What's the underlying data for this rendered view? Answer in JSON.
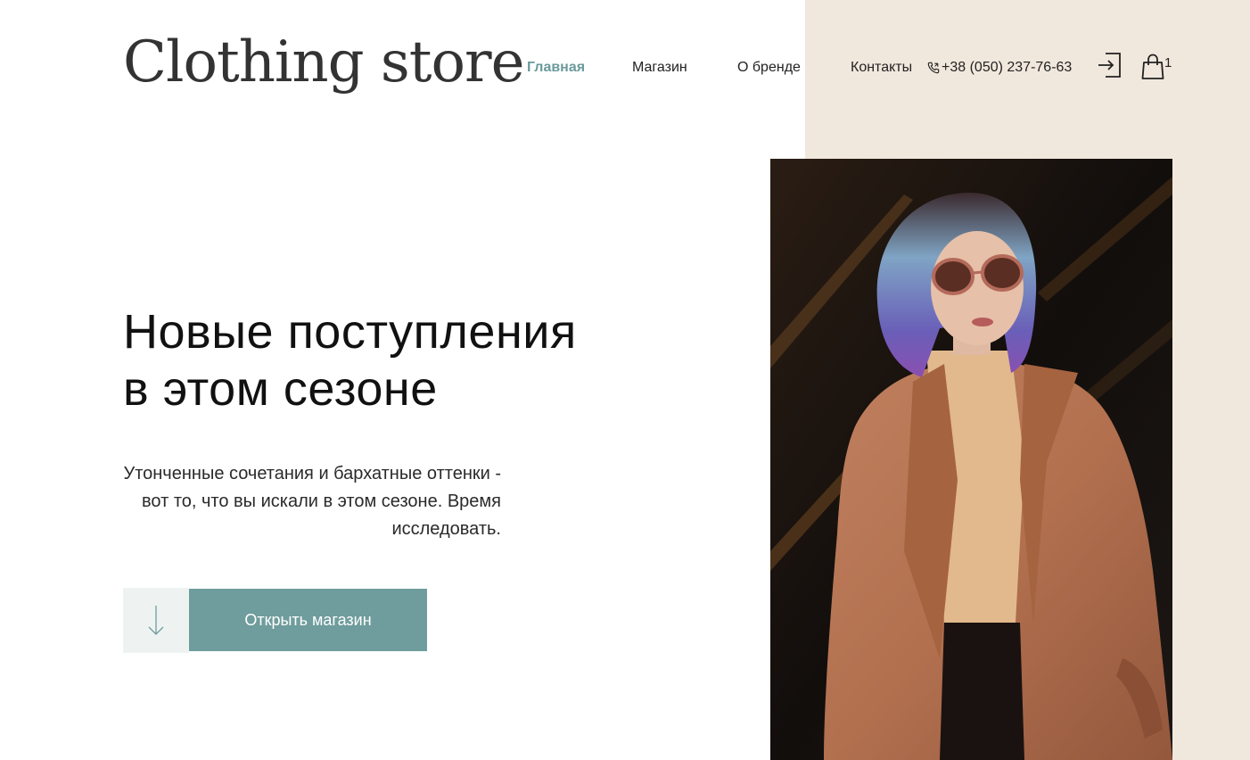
{
  "header": {
    "logo": "Clothing store",
    "nav": [
      {
        "label": "Главная",
        "active": true
      },
      {
        "label": "Магазин",
        "active": false
      },
      {
        "label": "О бренде",
        "active": false
      },
      {
        "label": "Контакты",
        "active": false
      }
    ],
    "phone": "+38 (050) 237-76-63",
    "phone_icon": "phone-icon",
    "login_icon": "sign-in-icon",
    "cart_icon": "shopping-bag-icon",
    "cart_count": "1"
  },
  "hero": {
    "title_line1": "Новые поступления",
    "title_line2": "в этом сезоне",
    "description": "Утонченные сочетания и бархатные оттенки - вот то, что вы искали в этом сезоне. Время исследовать.",
    "scroll_icon": "arrow-down-icon",
    "cta_label": "Открыть магазин",
    "image_subject": "woman-in-brown-coat-photo"
  },
  "colors": {
    "accent": "#6f9c9c",
    "accent_active_nav": "#6b9a9b",
    "beige_panel": "#f1e8dd",
    "arrow_box_bg": "#eef3f2",
    "text": "#1f1f1f"
  }
}
